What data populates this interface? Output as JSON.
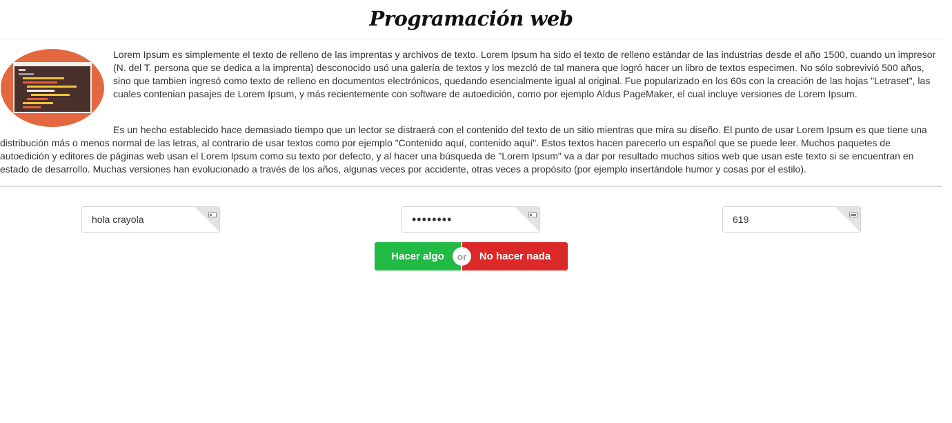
{
  "header": {
    "title": "Programación web"
  },
  "content": {
    "image_icon": "code-editor-illustration",
    "paragraph_1": "Lorem Ipsum es simplemente el texto de relleno de las imprentas y archivos de texto. Lorem Ipsum ha sido el texto de relleno estándar de las industrias desde el año 1500, cuando un impresor (N. del T. persona que se dedica a la imprenta) desconocido usó una galería de textos y los mezcló de tal manera que logró hacer un libro de textos especimen. No sólo sobrevivió 500 años, sino que tambien ingresó como texto de relleno en documentos electrónicos, quedando esencialmente igual al original. Fue popularizado en los 60s con la creación de las hojas \"Letraset\", las cuales contenian pasajes de Lorem Ipsum, y más recientemente con software de autoedición, como por ejemplo Aldus PageMaker, el cual incluye versiones de Lorem Ipsum.",
    "paragraph_2": "Es un hecho establecido hace demasiado tiempo que un lector se distraerá con el contenido del texto de un sitio mientras que mira su diseño. El punto de usar Lorem Ipsum es que tiene una distribución más o menos normal de las letras, al contrario de usar textos como por ejemplo \"Contenido aquí, contenido aquí\". Estos textos hacen parecerlo un español que se puede leer. Muchos paquetes de autoedición y editores de páginas web usan el Lorem Ipsum como su texto por defecto, y al hacer una búsqueda de \"Lorem Ipsum\" va a dar por resultado muchos sitios web que usan este texto si se encuentran en estado de desarrollo. Muchas versiones han evolucionado a través de los años, algunas veces por accidente, otras veces a propósito (por ejemplo insertándole humor y cosas por el estilo)."
  },
  "form": {
    "text_field": {
      "value": "hola crayola",
      "corner_icon": "toggle-off-icon"
    },
    "password_field": {
      "value": "holahola",
      "corner_icon": "toggle-off-icon"
    },
    "number_field": {
      "value": "619",
      "corner_icon": "toggle-on-icon"
    }
  },
  "actions": {
    "do_label": "Hacer algo",
    "or_label": "or",
    "nothing_label": "No hacer nada",
    "do_color": "#21ba45",
    "nothing_color": "#db2828"
  },
  "colors": {
    "illustration_background": "#e4683f",
    "screen_background": "#4a302b"
  }
}
